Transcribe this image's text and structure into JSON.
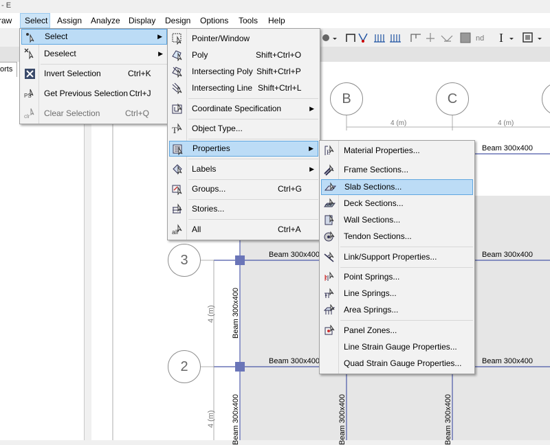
{
  "title_fragment": "- E",
  "menubar": {
    "items": [
      {
        "label": "raw"
      },
      {
        "label": "Select"
      },
      {
        "label": "Assign"
      },
      {
        "label": "Analyze"
      },
      {
        "label": "Display"
      },
      {
        "label": "Design"
      },
      {
        "label": "Options"
      },
      {
        "label": "Tools"
      },
      {
        "label": "Help"
      }
    ]
  },
  "left_tab": "orts",
  "toolbar": {
    "nd_label": "nd",
    "text_tool": "I"
  },
  "select_menu": {
    "items": [
      {
        "label": "Select",
        "shortcut": "",
        "icon": "select-icon",
        "has_sub": true,
        "highlighted": true
      },
      {
        "label": "Deselect",
        "shortcut": "",
        "icon": "deselect-icon",
        "has_sub": true
      },
      {
        "label": "Invert Selection",
        "shortcut": "Ctrl+K",
        "icon": "invert-selection-icon"
      },
      {
        "label": "Get Previous Selection",
        "shortcut": "Ctrl+J",
        "icon": "previous-selection-icon"
      },
      {
        "label": "Clear Selection",
        "shortcut": "Ctrl+Q",
        "icon": "clear-selection-icon",
        "disabled": true
      }
    ]
  },
  "icon_text": {
    "ps": "PS",
    "clr": "clr",
    "all": "all"
  },
  "sub_menu": {
    "items": [
      {
        "label": "Pointer/Window",
        "shortcut": ""
      },
      {
        "label": "Poly",
        "shortcut": "Shift+Ctrl+O"
      },
      {
        "label": "Intersecting Poly",
        "shortcut": "Shift+Ctrl+P"
      },
      {
        "label": "Intersecting Line",
        "shortcut": "Shift+Ctrl+L"
      },
      {
        "label": "Coordinate Specification",
        "shortcut": "",
        "has_sub": true
      },
      {
        "label": "Object Type...",
        "shortcut": ""
      },
      {
        "label": "Properties",
        "shortcut": "",
        "has_sub": true,
        "highlighted": true
      },
      {
        "label": "Labels",
        "shortcut": "",
        "has_sub": true
      },
      {
        "label": "Groups...",
        "shortcut": "Ctrl+G"
      },
      {
        "label": "Stories...",
        "shortcut": ""
      },
      {
        "label": "All",
        "shortcut": "Ctrl+A"
      }
    ]
  },
  "props_menu": {
    "items": [
      {
        "label": "Material Properties..."
      },
      {
        "label": "Frame Sections..."
      },
      {
        "label": "Slab Sections...",
        "highlighted": true
      },
      {
        "label": "Deck Sections..."
      },
      {
        "label": "Wall Sections..."
      },
      {
        "label": "Tendon Sections..."
      },
      {
        "label": "Link/Support Properties..."
      },
      {
        "label": "Point Springs..."
      },
      {
        "label": "Line Springs..."
      },
      {
        "label": "Area Springs..."
      },
      {
        "label": "Panel Zones..."
      },
      {
        "label": "Line Strain Gauge Properties..."
      },
      {
        "label": "Quad Strain Gauge Properties..."
      }
    ]
  },
  "drawing": {
    "grid_bubbles": [
      "B",
      "C",
      "3",
      "2"
    ],
    "dimension": "4 (m)",
    "beam_label": "Beam 300x400",
    "colors": {
      "highlight": "#bcdcf6",
      "highlight_border": "#5fa6e0",
      "slab": "#e6e6e6",
      "joint": "#6a75b8"
    }
  }
}
